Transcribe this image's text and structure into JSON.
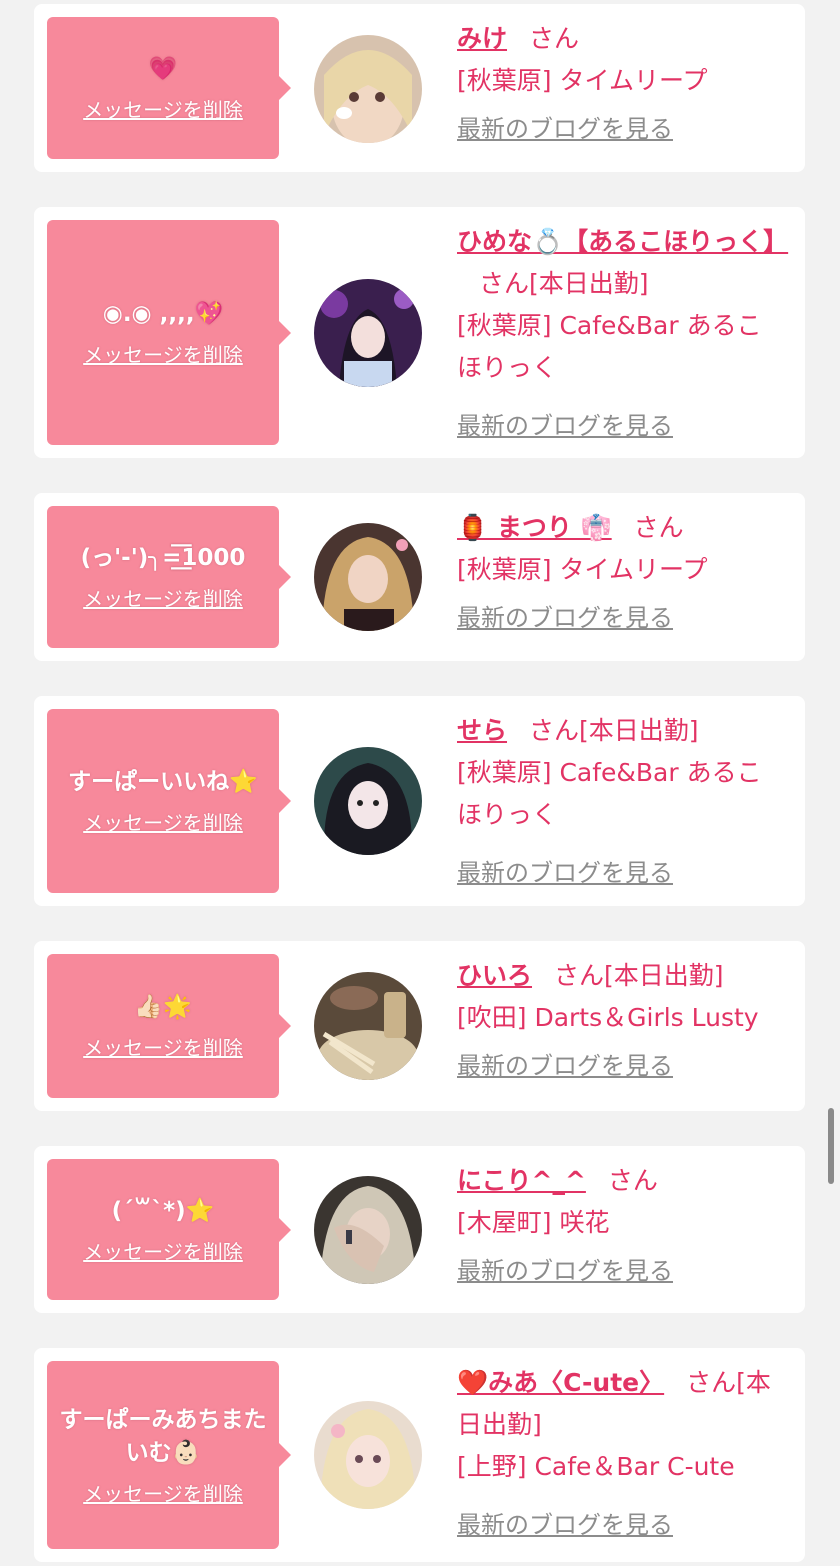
{
  "common": {
    "delete_label": "メッセージを削除",
    "blog_label": "最新のブログを見る",
    "san_label": "さん"
  },
  "colors": {
    "accent": "#e23364",
    "bubble": "#f7899b",
    "muted": "#8c8c8c",
    "background": "#f2f2f2"
  },
  "entries": [
    {
      "message": "💗",
      "name": "みけ",
      "status": "",
      "shop": "[秋葉原] タイムリープ"
    },
    {
      "message": "◉.◉ ,,,,💖",
      "name": "ひめな💍【あるこほりっく】",
      "status": "[本日出勤]",
      "shop": "[秋葉原] Cafe&Bar あるこほりっく"
    },
    {
      "message": "(っ'-')╮=͟͟͞͞1000",
      "name": "🏮 まつり 👘",
      "status": "",
      "shop": "[秋葉原] タイムリープ"
    },
    {
      "message": "すーぱーいいね⭐️",
      "name": "せら",
      "status": "[本日出勤]",
      "shop": "[秋葉原] Cafe&Bar あるこほりっく"
    },
    {
      "message": "👍🏻🌟",
      "name": "ひいろ",
      "status": "[本日出勤]",
      "shop": "[吹田] Darts＆Girls Lusty"
    },
    {
      "message": "(ˊ꒳ˋ*)⭐️",
      "name": "にこり^_^",
      "status": "",
      "shop": "[木屋町] 咲花"
    },
    {
      "message": "すーぱーみあちまたいむ👶🏻",
      "name": "❤️みあ〈C-ute〉",
      "status": "[本日出勤]",
      "shop": "[上野] Cafe＆Bar C-ute"
    }
  ]
}
